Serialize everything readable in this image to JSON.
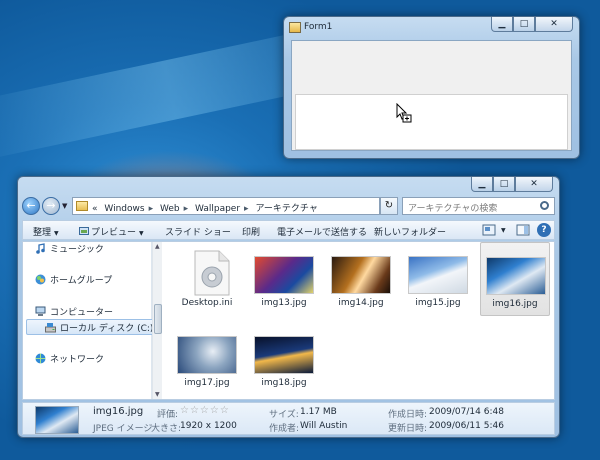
{
  "desktop": {},
  "form1": {
    "title": "Form1",
    "buttons": {
      "minimize": "▁",
      "maximize": "□",
      "close": "✕"
    }
  },
  "explorer": {
    "title_buttons": {
      "minimize": "▁",
      "maximize": "□",
      "close": "✕"
    },
    "address": {
      "overflow": "«",
      "crumbs": [
        "Windows",
        "Web",
        "Wallpaper",
        "アーキテクチャ"
      ],
      "refresh": "↻"
    },
    "search": {
      "placeholder": "アーキテクチャの検索"
    },
    "toolbar": {
      "organize": "整理",
      "preview": "プレビュー",
      "slideshow": "スライド ショー",
      "print": "印刷",
      "email": "電子メールで送信する",
      "new_folder": "新しいフォルダー",
      "help": "?"
    },
    "nav": [
      {
        "label": "ミュージック",
        "icon": "music-icon"
      },
      {
        "label": "ホームグループ",
        "icon": "homegroup-icon"
      },
      {
        "label": "コンピューター",
        "icon": "computer-icon"
      },
      {
        "label": "ローカル ディスク (C:)",
        "icon": "drive-icon",
        "selected": true
      },
      {
        "label": "ネットワーク",
        "icon": "network-icon"
      }
    ],
    "files": [
      {
        "name": "Desktop.ini",
        "kind": "settings-file-icon"
      },
      {
        "name": "img13.jpg",
        "kind": "image"
      },
      {
        "name": "img14.jpg",
        "kind": "image"
      },
      {
        "name": "img15.jpg",
        "kind": "image"
      },
      {
        "name": "img16.jpg",
        "kind": "image",
        "selected": true
      },
      {
        "name": "img17.jpg",
        "kind": "image"
      },
      {
        "name": "img18.jpg",
        "kind": "image"
      }
    ],
    "details": {
      "filename": "img16.jpg",
      "filetype": "JPEG イメージ",
      "rating_label": "評価:",
      "rating_stars": "☆☆☆☆☆",
      "dimensions_label": "大きさ:",
      "dimensions": "1920 x 1200",
      "size_label": "サイズ:",
      "size": "1.17 MB",
      "author_label": "作成者:",
      "author": "Will Austin",
      "created_label": "作成日時:",
      "created": "2009/07/14 6:48",
      "modified_label": "更新日時:",
      "modified": "2009/06/11 5:46"
    }
  }
}
